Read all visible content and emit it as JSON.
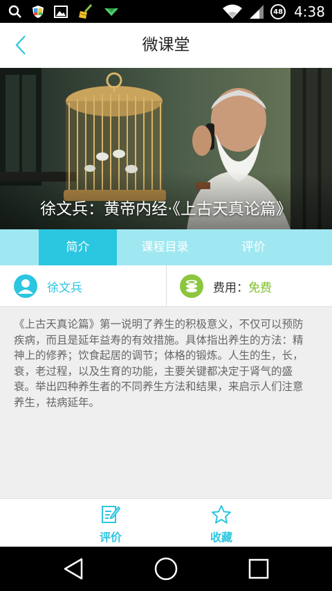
{
  "status_bar": {
    "time": "4:38",
    "battery_level": "48",
    "icons": [
      "search-icon",
      "shield-icon",
      "image-icon",
      "broom-icon",
      "arrow-icon",
      "wifi-icon",
      "signal-icon",
      "battery-icon"
    ]
  },
  "header": {
    "title": "微课堂",
    "back_icon": "chevron-left-icon"
  },
  "hero": {
    "title": "徐文兵：黄帝内经·《上古天真论篇》"
  },
  "tabs": [
    {
      "label": "简介",
      "active": true
    },
    {
      "label": "课程目录",
      "active": false
    },
    {
      "label": "评价",
      "active": false
    }
  ],
  "info": {
    "teacher_name": "徐文兵",
    "fee_label": "费用：",
    "fee_value": "免费"
  },
  "description": "《上古天真论篇》第一说明了养生的积极意义，不仅可以预防疾病，而且是延年益寿的有效措施。具体指出养生的方法：精神上的修养；饮食起居的调节；体格的锻炼。人生的生，长，衰，老过程，以及生育的功能，主要关键都决定于肾气的盛衰。举出四种养生者的不同养生方法和结果，来启示人们注意养生，祛病延年。",
  "actions": [
    {
      "label": "评价",
      "icon": "edit-icon"
    },
    {
      "label": "收藏",
      "icon": "star-icon"
    }
  ],
  "colors": {
    "accent": "#2bc6e0",
    "tab_bar": "#9fe8f2",
    "fee_green": "#7fbf2a"
  }
}
